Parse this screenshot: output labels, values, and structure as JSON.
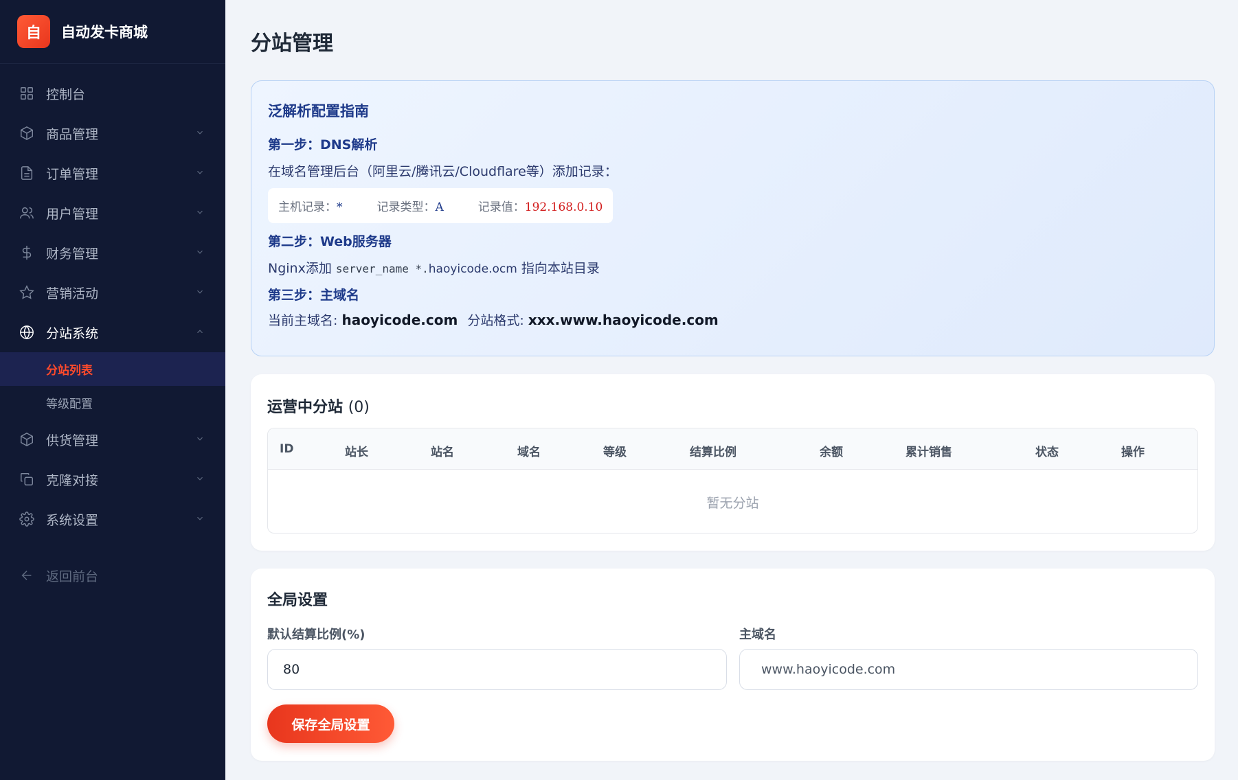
{
  "brand": {
    "logo_char": "自",
    "name": "自动发卡商城"
  },
  "sidebar": {
    "items": [
      {
        "label": "控制台",
        "icon": "dashboard-icon"
      },
      {
        "label": "商品管理",
        "icon": "box-icon"
      },
      {
        "label": "订单管理",
        "icon": "document-icon"
      },
      {
        "label": "用户管理",
        "icon": "users-icon"
      },
      {
        "label": "财务管理",
        "icon": "dollar-icon"
      },
      {
        "label": "营销活动",
        "icon": "star-icon"
      },
      {
        "label": "分站系统",
        "icon": "globe-icon"
      },
      {
        "label": "供货管理",
        "icon": "box-icon"
      },
      {
        "label": "克隆对接",
        "icon": "copy-icon"
      },
      {
        "label": "系统设置",
        "icon": "gear-icon"
      }
    ],
    "sub_items": [
      {
        "label": "分站列表",
        "active": true
      },
      {
        "label": "等级配置",
        "active": false
      }
    ],
    "back_label": "返回前台"
  },
  "page": {
    "title": "分站管理"
  },
  "guide": {
    "title": "泛解析配置指南",
    "step1_title": "第一步：DNS解析",
    "step1_text": "在域名管理后台（阿里云/腾讯云/Cloudflare等）添加记录：",
    "record_host_label": "主机记录：",
    "record_host_value": "*",
    "record_type_label": "记录类型：",
    "record_type_value": "A",
    "record_value_label": "记录值：",
    "record_value_value": "192.168.0.10",
    "step2_title": "第二步：Web服务器",
    "step2_prefix": "Nginx添加 ",
    "step2_code": "server_name *.",
    "step2_domain": "haoyicode.ocm",
    "step2_suffix": " 指向本站目录",
    "step3_title": "第三步：主域名",
    "main_domain_label": "当前主域名: ",
    "main_domain_value": "haoyicode.com",
    "sub_format_label": "分站格式: ",
    "sub_format_value": "xxx.www.haoyicode.com"
  },
  "sites": {
    "title": "运营中分站",
    "count": "(0)",
    "columns": [
      "ID",
      "站长",
      "站名",
      "域名",
      "等级",
      "结算比例",
      "余额",
      "累计销售",
      "状态",
      "操作"
    ],
    "empty_text": "暂无分站"
  },
  "settings": {
    "title": "全局设置",
    "ratio_label": "默认结算比例(%)",
    "ratio_value": "80",
    "domain_label": "主域名",
    "domain_placeholder": "www.haoyicode.com",
    "save_label": "保存全局设置"
  },
  "colors": {
    "accent": "#e8361d",
    "sidebar_bg": "#111933",
    "guide_text": "#1e3a8a"
  }
}
